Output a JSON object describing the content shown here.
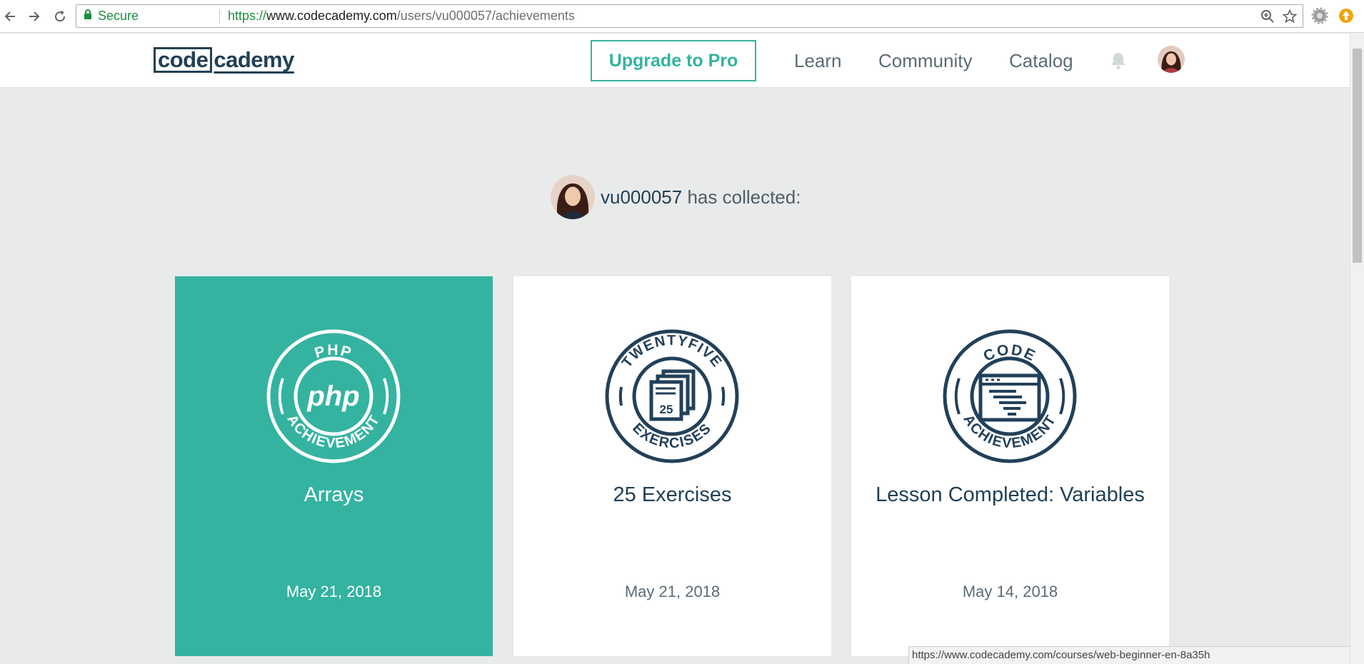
{
  "browser": {
    "secure_label": "Secure",
    "url_scheme": "https://",
    "url_domain": "www.codecademy.com",
    "url_path": "/users/vu000057/achievements",
    "icons": [
      "back-arrow-icon",
      "forward-arrow-icon",
      "reload-icon",
      "lock-icon",
      "zoom-icon",
      "star-icon",
      "settings-extension-icon",
      "orange-extension-icon"
    ]
  },
  "header": {
    "logo_box": "code",
    "logo_rest": "cademy",
    "upgrade_label": "Upgrade to Pro",
    "nav": [
      "Learn",
      "Community",
      "Catalog"
    ],
    "icons": [
      "bell-icon",
      "user-avatar"
    ]
  },
  "profile": {
    "username": "vu000057",
    "collected_suffix": "has collected:"
  },
  "achievements": [
    {
      "title": "Arrays",
      "date": "May 21, 2018",
      "badge_top": "PHP",
      "badge_center": "php",
      "badge_bottom": "ACHIEVEMENT",
      "highlighted": true
    },
    {
      "title": "25 Exercises",
      "date": "May 21, 2018",
      "badge_top": "TWENTYFIVE",
      "badge_center": "25",
      "badge_bottom": "EXERCISES",
      "highlighted": false
    },
    {
      "title": "Lesson Completed: Variables",
      "date": "May 14, 2018",
      "badge_top": "CODE",
      "badge_center": "",
      "badge_bottom": "ACHIEVEMENT",
      "highlighted": false
    }
  ],
  "status_bar_url": "https://www.codecademy.com/courses/web-beginner-en-8a35h",
  "colors": {
    "accent": "#34b3a0",
    "brand_navy": "#204056",
    "page_bg": "#e9eaea"
  }
}
